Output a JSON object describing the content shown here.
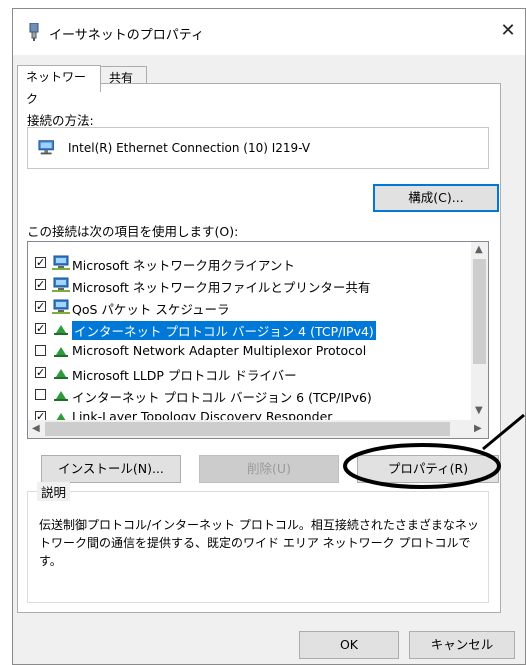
{
  "window": {
    "title": "イーサネットのプロパティ",
    "close_glyph": "✕"
  },
  "tabs": [
    {
      "label": "ネットワーク",
      "active": true
    },
    {
      "label": "共有",
      "active": false
    }
  ],
  "connect_using": {
    "label": "接続の方法:",
    "adapter_name": "Intel(R) Ethernet Connection (10) I219-V"
  },
  "configure_button": "構成(C)...",
  "items_label": "この接続は次の項目を使用します(O):",
  "items": [
    {
      "label": "Microsoft ネットワーク用クライアント",
      "checked": true,
      "icon": "network-client-icon",
      "selected": false
    },
    {
      "label": "Microsoft ネットワーク用ファイルとプリンター共有",
      "checked": true,
      "icon": "file-printer-sharing-icon",
      "selected": false
    },
    {
      "label": "QoS パケット スケジューラ",
      "checked": true,
      "icon": "qos-scheduler-icon",
      "selected": false
    },
    {
      "label": "インターネット プロトコル バージョン 4 (TCP/IPv4)",
      "checked": true,
      "icon": "protocol-icon",
      "selected": true
    },
    {
      "label": "Microsoft Network Adapter Multiplexor Protocol",
      "checked": false,
      "icon": "protocol-icon",
      "selected": false
    },
    {
      "label": "Microsoft LLDP プロトコル ドライバー",
      "checked": true,
      "icon": "protocol-icon",
      "selected": false
    },
    {
      "label": "インターネット プロトコル バージョン 6 (TCP/IPv6)",
      "checked": false,
      "icon": "protocol-icon",
      "selected": false
    },
    {
      "label": "Link-Layer Topology Discovery Responder",
      "checked": true,
      "icon": "protocol-icon",
      "selected": false
    }
  ],
  "buttons": {
    "install": "インストール(N)...",
    "uninstall": "削除(U)",
    "properties": "プロパティ(R)",
    "ok": "OK",
    "cancel": "キャンセル"
  },
  "description": {
    "legend": "説明",
    "text": "伝送制御プロトコル/インターネット プロトコル。相互接続されたさまざまなネットワーク間の通信を提供する、既定のワイド エリア ネットワーク プロトコルです。"
  },
  "colors": {
    "selection": "#0078d7",
    "annotation": "#000000"
  }
}
